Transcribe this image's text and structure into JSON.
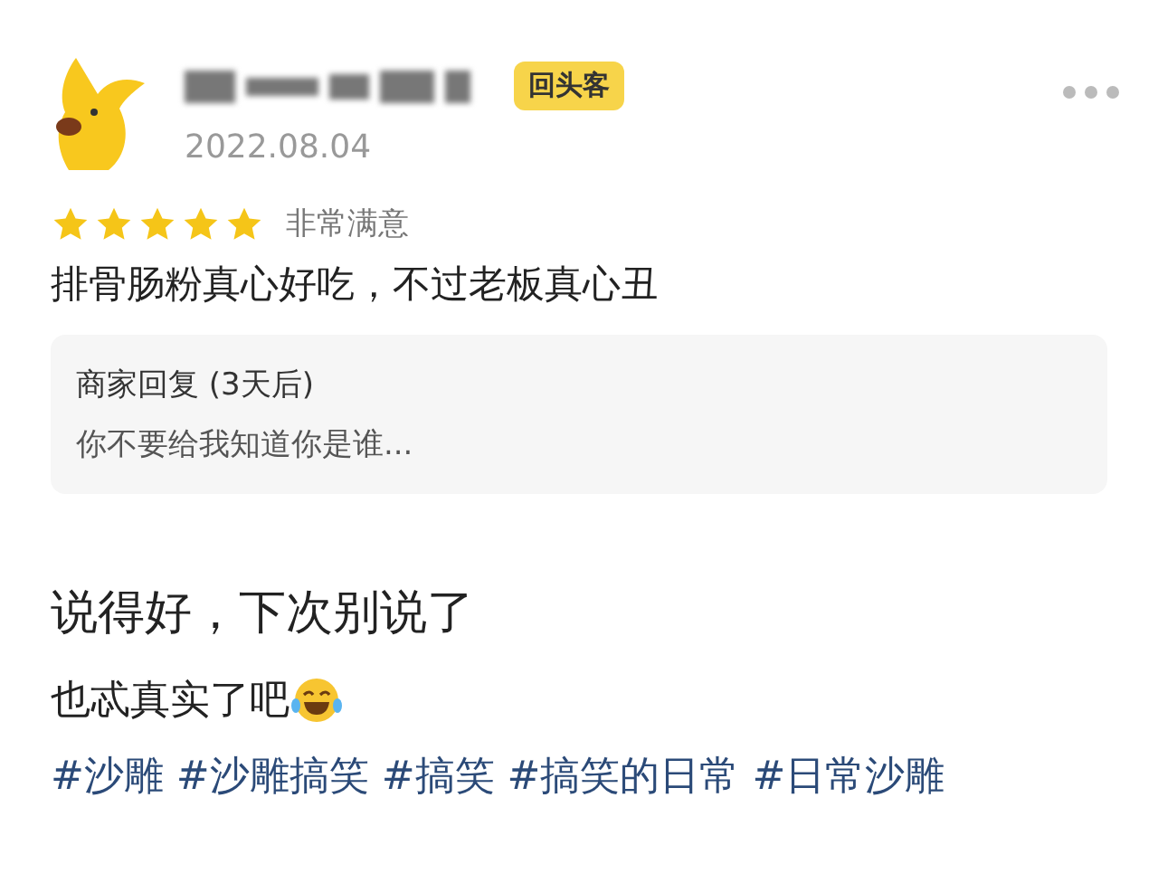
{
  "review": {
    "badge": "回头客",
    "date": "2022.08.04",
    "stars": 5,
    "rating_label": "非常满意",
    "text": "排骨肠粉真心好吃，不过老板真心丑",
    "merchant_reply": {
      "title": "商家回复 (3天后)",
      "text": "你不要给我知道你是谁..."
    }
  },
  "post": {
    "lines": [
      "说得好，下次别说了",
      "也忒真实了吧"
    ],
    "hashtags": "#沙雕 #沙雕搞笑 #搞笑 #搞笑的日常 #日常沙雕"
  }
}
